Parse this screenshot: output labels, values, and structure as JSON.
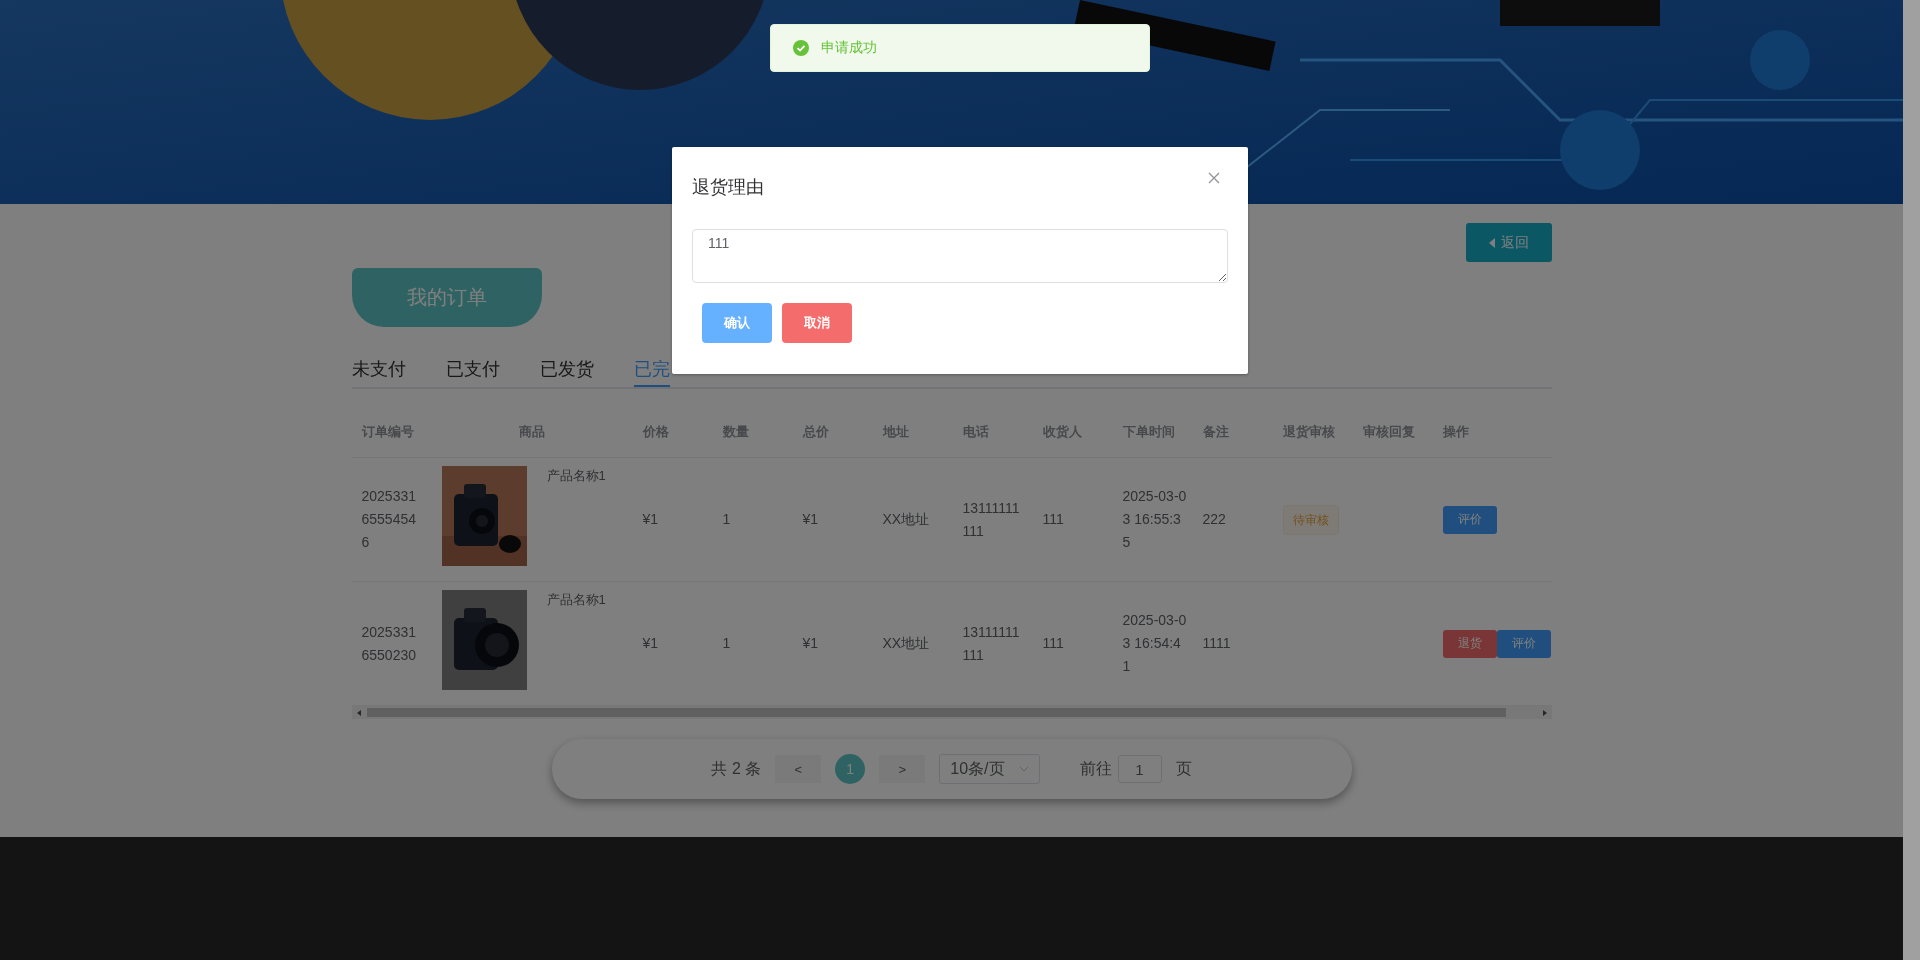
{
  "toast": {
    "kind": "success",
    "text": "申请成功"
  },
  "banner": {
    "kind": "picture"
  },
  "back_button": {
    "label": "返回"
  },
  "page_title": "我的订单",
  "tabs": [
    {
      "label": "未支付",
      "selected": false
    },
    {
      "label": "已支付",
      "selected": false
    },
    {
      "label": "已发货",
      "selected": false
    },
    {
      "label": "已完",
      "selected": true
    }
  ],
  "table": {
    "columns": [
      "订单编号",
      "商品",
      "价格",
      "数量",
      "总价",
      "地址",
      "电话",
      "收货人",
      "下单时间",
      "备注",
      "退货审核",
      "审核回复",
      "操作"
    ],
    "rows": [
      {
        "order_no": "202533165554546",
        "image": {
          "kind": "picture"
        },
        "product": "产品名称1",
        "price": "¥1",
        "quantity": "1",
        "total": "¥1",
        "address": "XX地址",
        "phone": "13111111111",
        "receiver": "111",
        "order_time": "2025-03-03 16:55:35",
        "note": "222",
        "return_status": "待审核",
        "actions": [
          {
            "kind": "review",
            "label": "评价"
          }
        ]
      },
      {
        "order_no": "20253316550230",
        "image": {
          "kind": "picture"
        },
        "product": "产品名称1",
        "price": "¥1",
        "quantity": "1",
        "total": "¥1",
        "address": "XX地址",
        "phone": "13111111111",
        "receiver": "111",
        "order_time": "2025-03-03 16:54:41",
        "note": "1111",
        "actions": [
          {
            "kind": "return",
            "label": "退货"
          },
          {
            "kind": "review",
            "label": "评价"
          }
        ]
      }
    ]
  },
  "pagination": {
    "total": "共 2 条",
    "prev": "<",
    "pages": [
      {
        "label": "1",
        "selected": true
      }
    ],
    "next": ">",
    "page_size": "10条/页",
    "goto_label": "前往",
    "goto_value": "1",
    "page_unit": "页"
  },
  "modal": {
    "title": "退货理由",
    "reason": "111",
    "buttons": [
      {
        "kind": "confirm",
        "label": "确认"
      },
      {
        "kind": "cancel",
        "label": "取消"
      }
    ]
  }
}
